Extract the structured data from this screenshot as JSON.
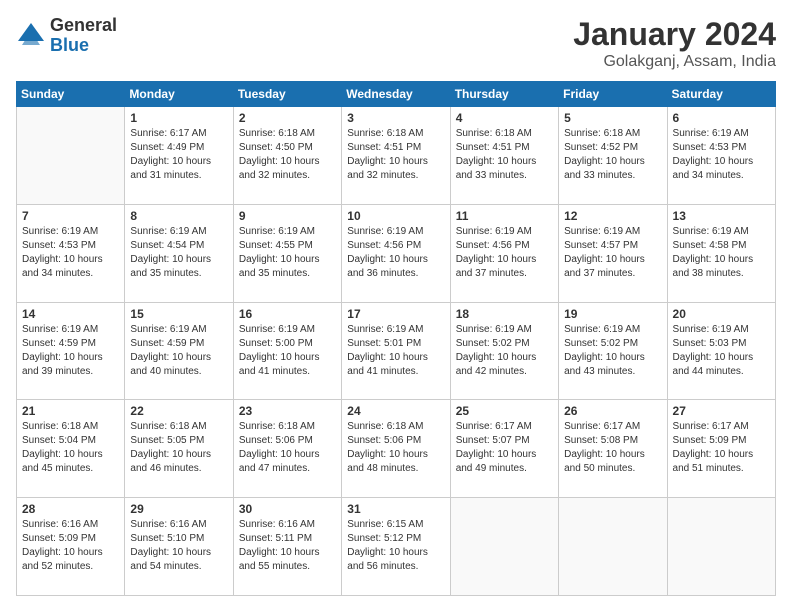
{
  "logo": {
    "general": "General",
    "blue": "Blue"
  },
  "title": "January 2024",
  "location": "Golakganj, Assam, India",
  "headers": [
    "Sunday",
    "Monday",
    "Tuesday",
    "Wednesday",
    "Thursday",
    "Friday",
    "Saturday"
  ],
  "weeks": [
    [
      {
        "num": "",
        "sunrise": "",
        "sunset": "",
        "daylight": "",
        "empty": true
      },
      {
        "num": "1",
        "sunrise": "6:17 AM",
        "sunset": "4:49 PM",
        "daylight": "10 hours and 31 minutes."
      },
      {
        "num": "2",
        "sunrise": "6:18 AM",
        "sunset": "4:50 PM",
        "daylight": "10 hours and 32 minutes."
      },
      {
        "num": "3",
        "sunrise": "6:18 AM",
        "sunset": "4:51 PM",
        "daylight": "10 hours and 32 minutes."
      },
      {
        "num": "4",
        "sunrise": "6:18 AM",
        "sunset": "4:51 PM",
        "daylight": "10 hours and 33 minutes."
      },
      {
        "num": "5",
        "sunrise": "6:18 AM",
        "sunset": "4:52 PM",
        "daylight": "10 hours and 33 minutes."
      },
      {
        "num": "6",
        "sunrise": "6:19 AM",
        "sunset": "4:53 PM",
        "daylight": "10 hours and 34 minutes."
      }
    ],
    [
      {
        "num": "7",
        "sunrise": "6:19 AM",
        "sunset": "4:53 PM",
        "daylight": "10 hours and 34 minutes."
      },
      {
        "num": "8",
        "sunrise": "6:19 AM",
        "sunset": "4:54 PM",
        "daylight": "10 hours and 35 minutes."
      },
      {
        "num": "9",
        "sunrise": "6:19 AM",
        "sunset": "4:55 PM",
        "daylight": "10 hours and 35 minutes."
      },
      {
        "num": "10",
        "sunrise": "6:19 AM",
        "sunset": "4:56 PM",
        "daylight": "10 hours and 36 minutes."
      },
      {
        "num": "11",
        "sunrise": "6:19 AM",
        "sunset": "4:56 PM",
        "daylight": "10 hours and 37 minutes."
      },
      {
        "num": "12",
        "sunrise": "6:19 AM",
        "sunset": "4:57 PM",
        "daylight": "10 hours and 37 minutes."
      },
      {
        "num": "13",
        "sunrise": "6:19 AM",
        "sunset": "4:58 PM",
        "daylight": "10 hours and 38 minutes."
      }
    ],
    [
      {
        "num": "14",
        "sunrise": "6:19 AM",
        "sunset": "4:59 PM",
        "daylight": "10 hours and 39 minutes."
      },
      {
        "num": "15",
        "sunrise": "6:19 AM",
        "sunset": "4:59 PM",
        "daylight": "10 hours and 40 minutes."
      },
      {
        "num": "16",
        "sunrise": "6:19 AM",
        "sunset": "5:00 PM",
        "daylight": "10 hours and 41 minutes."
      },
      {
        "num": "17",
        "sunrise": "6:19 AM",
        "sunset": "5:01 PM",
        "daylight": "10 hours and 41 minutes."
      },
      {
        "num": "18",
        "sunrise": "6:19 AM",
        "sunset": "5:02 PM",
        "daylight": "10 hours and 42 minutes."
      },
      {
        "num": "19",
        "sunrise": "6:19 AM",
        "sunset": "5:02 PM",
        "daylight": "10 hours and 43 minutes."
      },
      {
        "num": "20",
        "sunrise": "6:19 AM",
        "sunset": "5:03 PM",
        "daylight": "10 hours and 44 minutes."
      }
    ],
    [
      {
        "num": "21",
        "sunrise": "6:18 AM",
        "sunset": "5:04 PM",
        "daylight": "10 hours and 45 minutes."
      },
      {
        "num": "22",
        "sunrise": "6:18 AM",
        "sunset": "5:05 PM",
        "daylight": "10 hours and 46 minutes."
      },
      {
        "num": "23",
        "sunrise": "6:18 AM",
        "sunset": "5:06 PM",
        "daylight": "10 hours and 47 minutes."
      },
      {
        "num": "24",
        "sunrise": "6:18 AM",
        "sunset": "5:06 PM",
        "daylight": "10 hours and 48 minutes."
      },
      {
        "num": "25",
        "sunrise": "6:17 AM",
        "sunset": "5:07 PM",
        "daylight": "10 hours and 49 minutes."
      },
      {
        "num": "26",
        "sunrise": "6:17 AM",
        "sunset": "5:08 PM",
        "daylight": "10 hours and 50 minutes."
      },
      {
        "num": "27",
        "sunrise": "6:17 AM",
        "sunset": "5:09 PM",
        "daylight": "10 hours and 51 minutes."
      }
    ],
    [
      {
        "num": "28",
        "sunrise": "6:16 AM",
        "sunset": "5:09 PM",
        "daylight": "10 hours and 52 minutes."
      },
      {
        "num": "29",
        "sunrise": "6:16 AM",
        "sunset": "5:10 PM",
        "daylight": "10 hours and 54 minutes."
      },
      {
        "num": "30",
        "sunrise": "6:16 AM",
        "sunset": "5:11 PM",
        "daylight": "10 hours and 55 minutes."
      },
      {
        "num": "31",
        "sunrise": "6:15 AM",
        "sunset": "5:12 PM",
        "daylight": "10 hours and 56 minutes."
      },
      {
        "num": "",
        "sunrise": "",
        "sunset": "",
        "daylight": "",
        "empty": true
      },
      {
        "num": "",
        "sunrise": "",
        "sunset": "",
        "daylight": "",
        "empty": true
      },
      {
        "num": "",
        "sunrise": "",
        "sunset": "",
        "daylight": "",
        "empty": true
      }
    ]
  ]
}
